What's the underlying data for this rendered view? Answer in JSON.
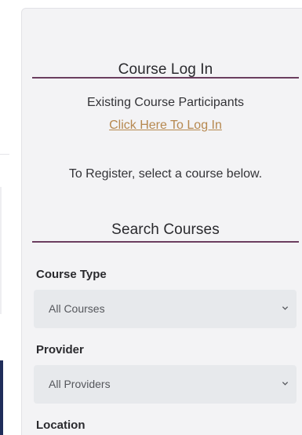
{
  "login": {
    "heading": "Course Log In",
    "existing_text": "Existing Course Participants",
    "login_link": "Click Here To Log In",
    "register_text": "To Register, select a course below."
  },
  "search": {
    "heading": "Search Courses",
    "fields": [
      {
        "label": "Course Type",
        "value": "All Courses"
      },
      {
        "label": "Provider",
        "value": "All Providers"
      },
      {
        "label": "Location"
      }
    ]
  },
  "colors": {
    "divider": "#6b3e5f",
    "link": "#b6884f",
    "panel": "#f3f3f5",
    "select": "#e7e9ec"
  },
  "icons": {
    "dropdown": "chevron-down-icon"
  }
}
